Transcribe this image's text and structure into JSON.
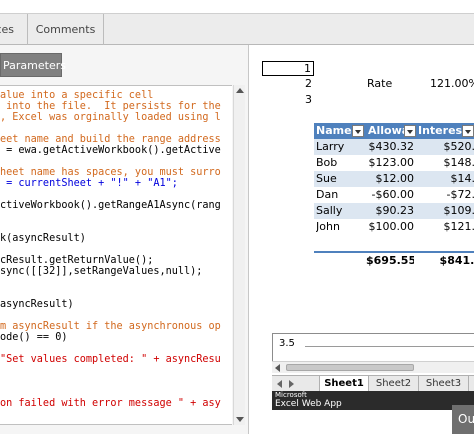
{
  "tabs": [
    {
      "label": "ces"
    },
    {
      "label": "Comments"
    }
  ],
  "parameters_button": {
    "label": "Parameters"
  },
  "code": {
    "lines": [
      {
        "text": "alue into a specific cell",
        "color": "#d2691e"
      },
      {
        "text": " into the file.  It persists for the",
        "color": "#d2691e"
      },
      {
        "text": ", Excel was orginally loaded using l",
        "color": "#d2691e"
      },
      {
        "text": "",
        "color": "#000000"
      },
      {
        "text": "eet name and build the range address",
        "color": "#d2691e"
      },
      {
        "text": " = ewa.getActiveWorkbook().getActive",
        "color": "#000000"
      },
      {
        "text": "",
        "color": "#000000"
      },
      {
        "text": "heet name has spaces, you must surro",
        "color": "#d2691e"
      },
      {
        "text": " = currentSheet + \"!\" + \"A1\";",
        "color": "#0000dd"
      },
      {
        "text": "",
        "color": "#000000"
      },
      {
        "text": "ctiveWorkbook().getRangeA1Async(rang",
        "color": "#000000"
      },
      {
        "text": "",
        "color": "#000000"
      },
      {
        "text": "",
        "color": "#000000"
      },
      {
        "text": "k(asyncResult)",
        "color": "#000000"
      },
      {
        "text": "",
        "color": "#000000"
      },
      {
        "text": "cResult.getReturnValue();",
        "color": "#000000"
      },
      {
        "text": "sync([[32]],setRangeValues,null);",
        "color": "#000000"
      },
      {
        "text": "",
        "color": "#000000"
      },
      {
        "text": "",
        "color": "#000000"
      },
      {
        "text": "asyncResult)",
        "color": "#000000"
      },
      {
        "text": "",
        "color": "#000000"
      },
      {
        "text": "m asyncResult if the asynchronous op",
        "color": "#d2691e"
      },
      {
        "text": "ode() == 0)",
        "color": "#000000"
      },
      {
        "text": "",
        "color": "#000000"
      },
      {
        "text": "\"Set values completed: \" + asyncResu",
        "color": "#d00000"
      },
      {
        "text": "",
        "color": "#000000"
      },
      {
        "text": "",
        "color": "#000000"
      },
      {
        "text": "",
        "color": "#000000"
      },
      {
        "text": "on failed with error message \" + asy",
        "color": "#d00000"
      }
    ]
  },
  "sheet": {
    "cells": {
      "a1": "1",
      "a2": "2",
      "a3": "3",
      "rate_label": "Rate",
      "rate_value": "121.00%"
    },
    "table": {
      "headers": [
        "Name",
        "Allowa",
        "Interest"
      ],
      "rows": [
        {
          "name": "Larry",
          "allowance": "$430.32",
          "interest": "$520.6"
        },
        {
          "name": "Bob",
          "allowance": "$123.00",
          "interest": "$148.8"
        },
        {
          "name": "Sue",
          "allowance": "$12.00",
          "interest": "$14.5"
        },
        {
          "name": "Dan",
          "allowance": "-$60.00",
          "interest": "-$72.6"
        },
        {
          "name": "Sally",
          "allowance": "$90.23",
          "interest": "$109.1"
        },
        {
          "name": "John",
          "allowance": "$100.00",
          "interest": "$121.0"
        }
      ],
      "total": {
        "allowance": "$695.55",
        "interest": "$841.6"
      }
    },
    "chart": {
      "tick": "3.5"
    },
    "sheet_tabs": [
      "Sheet1",
      "Sheet2",
      "Sheet3"
    ],
    "footer": {
      "company": "Microsoft",
      "app": "Excel Web App"
    }
  },
  "bottom_button": {
    "label": "Ou"
  },
  "colors": {
    "table_header": "#4f81bd",
    "table_band": "#dce6f1",
    "comment": "#d2691e",
    "string": "#d00000",
    "variable": "#0000dd"
  }
}
